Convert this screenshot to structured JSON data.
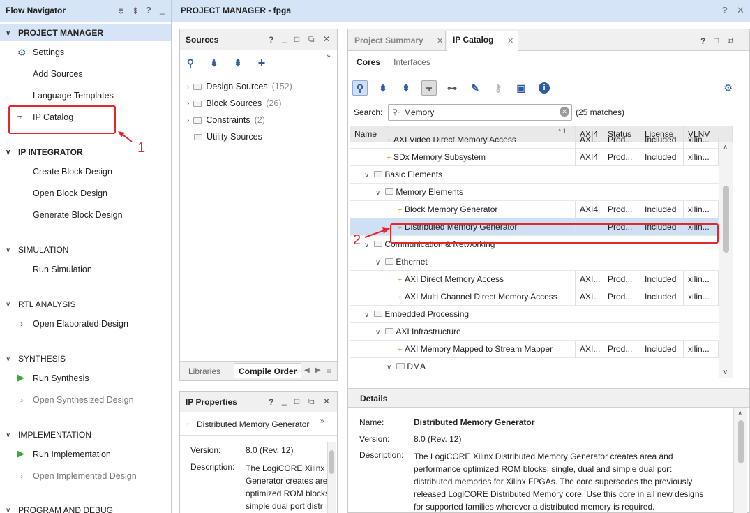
{
  "flow_navigator": {
    "title": "Flow Navigator",
    "sections": [
      {
        "title": "PROJECT MANAGER",
        "items": [
          "Settings",
          "Add Sources",
          "Language Templates",
          "IP Catalog"
        ]
      },
      {
        "title": "IP INTEGRATOR",
        "items": [
          "Create Block Design",
          "Open Block Design",
          "Generate Block Design"
        ]
      },
      {
        "title": "SIMULATION",
        "items": [
          "Run Simulation"
        ]
      },
      {
        "title": "RTL ANALYSIS",
        "items": [
          "Open Elaborated Design"
        ]
      },
      {
        "title": "SYNTHESIS",
        "items": [
          "Run Synthesis",
          "Open Synthesized Design"
        ]
      },
      {
        "title": "IMPLEMENTATION",
        "items": [
          "Run Implementation",
          "Open Implemented Design"
        ]
      },
      {
        "title": "PROGRAM AND DEBUG",
        "items": []
      }
    ]
  },
  "main_header": {
    "title": "PROJECT MANAGER - fpga",
    "help": "?",
    "close": "✕"
  },
  "sources": {
    "title": "Sources",
    "tree": [
      {
        "label": "Design Sources",
        "count": "(152)"
      },
      {
        "label": "Block Sources",
        "count": "(26)"
      },
      {
        "label": "Constraints",
        "count": "(2)"
      },
      {
        "label": "Utility Sources",
        "count": ""
      }
    ],
    "tabs": [
      "Libraries",
      "Compile Order"
    ]
  },
  "ip_properties": {
    "title": "IP Properties",
    "name": "Distributed Memory Generator",
    "version_label": "Version:",
    "version": "8.0 (Rev. 12)",
    "description_label": "Description:",
    "description_lines": [
      "The LogiCORE Xilinx",
      "Generator creates are",
      "optimized ROM blocks",
      "simple dual port distr"
    ]
  },
  "tabs": {
    "project_summary": "Project Summary",
    "ip_catalog": "IP Catalog"
  },
  "subtabs": {
    "cores": "Cores",
    "sep": "|",
    "interfaces": "Interfaces"
  },
  "search": {
    "label": "Search:",
    "value": "Memory",
    "matches": "(25 matches)"
  },
  "table": {
    "columns": [
      "Name",
      "AXI4",
      "Status",
      "License",
      "VLNV"
    ],
    "sort_indicator": "^ 1",
    "rows": [
      {
        "name": "AXI Video Direct Memory Access",
        "axi": "AXI...",
        "status": "Prod...",
        "license": "Included",
        "vlnv": "xilin..."
      },
      {
        "name": "SDx Memory Subsystem",
        "axi": "AXI4",
        "status": "Prod...",
        "license": "Included",
        "vlnv": "xilin..."
      },
      {
        "name": "Basic Elements",
        "axi": "",
        "status": "",
        "license": "",
        "vlnv": ""
      },
      {
        "name": "Memory Elements",
        "axi": "",
        "status": "",
        "license": "",
        "vlnv": ""
      },
      {
        "name": "Block Memory Generator",
        "axi": "AXI4",
        "status": "Prod...",
        "license": "Included",
        "vlnv": "xilin..."
      },
      {
        "name": "Distributed Memory Generator",
        "axi": "",
        "status": "Prod...",
        "license": "Included",
        "vlnv": "xilin..."
      },
      {
        "name": "Communication & Networking",
        "axi": "",
        "status": "",
        "license": "",
        "vlnv": ""
      },
      {
        "name": "Ethernet",
        "axi": "",
        "status": "",
        "license": "",
        "vlnv": ""
      },
      {
        "name": "AXI Direct Memory Access",
        "axi": "AXI...",
        "status": "Prod...",
        "license": "Included",
        "vlnv": "xilin..."
      },
      {
        "name": "AXI Multi Channel Direct Memory Access",
        "axi": "AXI...",
        "status": "Prod...",
        "license": "Included",
        "vlnv": "xilin..."
      },
      {
        "name": "Embedded Processing",
        "axi": "",
        "status": "",
        "license": "",
        "vlnv": ""
      },
      {
        "name": "AXI Infrastructure",
        "axi": "",
        "status": "",
        "license": "",
        "vlnv": ""
      },
      {
        "name": "AXI Memory Mapped to Stream Mapper",
        "axi": "AXI...",
        "status": "Prod...",
        "license": "Included",
        "vlnv": "xilin..."
      },
      {
        "name": "DMA",
        "axi": "",
        "status": "",
        "license": "",
        "vlnv": ""
      }
    ]
  },
  "details": {
    "title": "Details",
    "name_label": "Name:",
    "name": "Distributed Memory Generator",
    "version_label": "Version:",
    "version": "8.0 (Rev. 12)",
    "description_label": "Description:",
    "description_lines": [
      "The LogiCORE Xilinx Distributed Memory Generator creates area and",
      "performance optimized ROM blocks, single, dual and simple dual port",
      "distributed memories for Xilinx FPGAs. The core supersedes the previously",
      "released LogiCORE Distributed Memory core. Use this core in all new designs",
      "for supported families wherever a distributed memory is required."
    ]
  },
  "annotations": {
    "one": "1",
    "two": "2"
  },
  "colors": {
    "header_bg": "#d6e4f7",
    "selection": "#cfe0f5",
    "highlight_box": "#e3282b",
    "run_green": "#3aa83a"
  }
}
